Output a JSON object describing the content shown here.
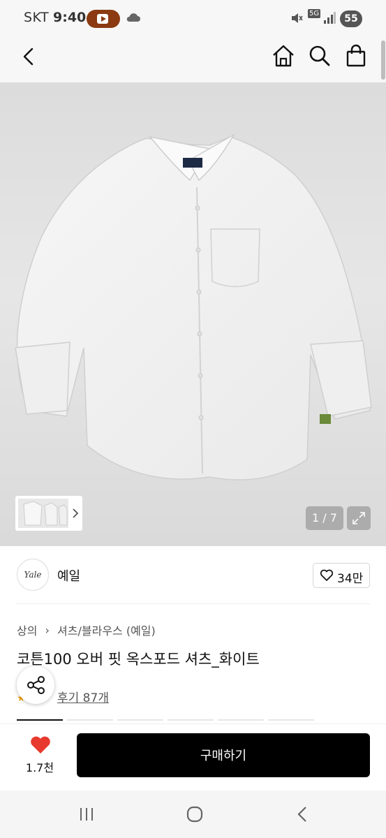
{
  "status_bar": {
    "carrier": "SKT",
    "time": "9:40",
    "network": "5G",
    "battery": "55"
  },
  "header": {
    "back_icon": "chevron-left-icon",
    "home_icon": "home-icon",
    "search_icon": "search-icon",
    "bag_icon": "shopping-bag-icon"
  },
  "gallery": {
    "pager": "1 / 7",
    "expand_icon": "expand-icon"
  },
  "brand": {
    "logo_text": "Yale",
    "name": "예일",
    "likes": "34만"
  },
  "product": {
    "breadcrumb": [
      "상의",
      "셔츠/블라우스 (예일)"
    ],
    "title": "코튼100 오버 핏 옥스포드 셔츠_화이트",
    "review": "후기 87개"
  },
  "buy_bar": {
    "wish_count": "1.7천",
    "buy_label": "구매하기"
  },
  "colors": {
    "accent_red": "#e8392e",
    "buy_button": "#000000",
    "youtube_pill": "#8b3a12"
  }
}
